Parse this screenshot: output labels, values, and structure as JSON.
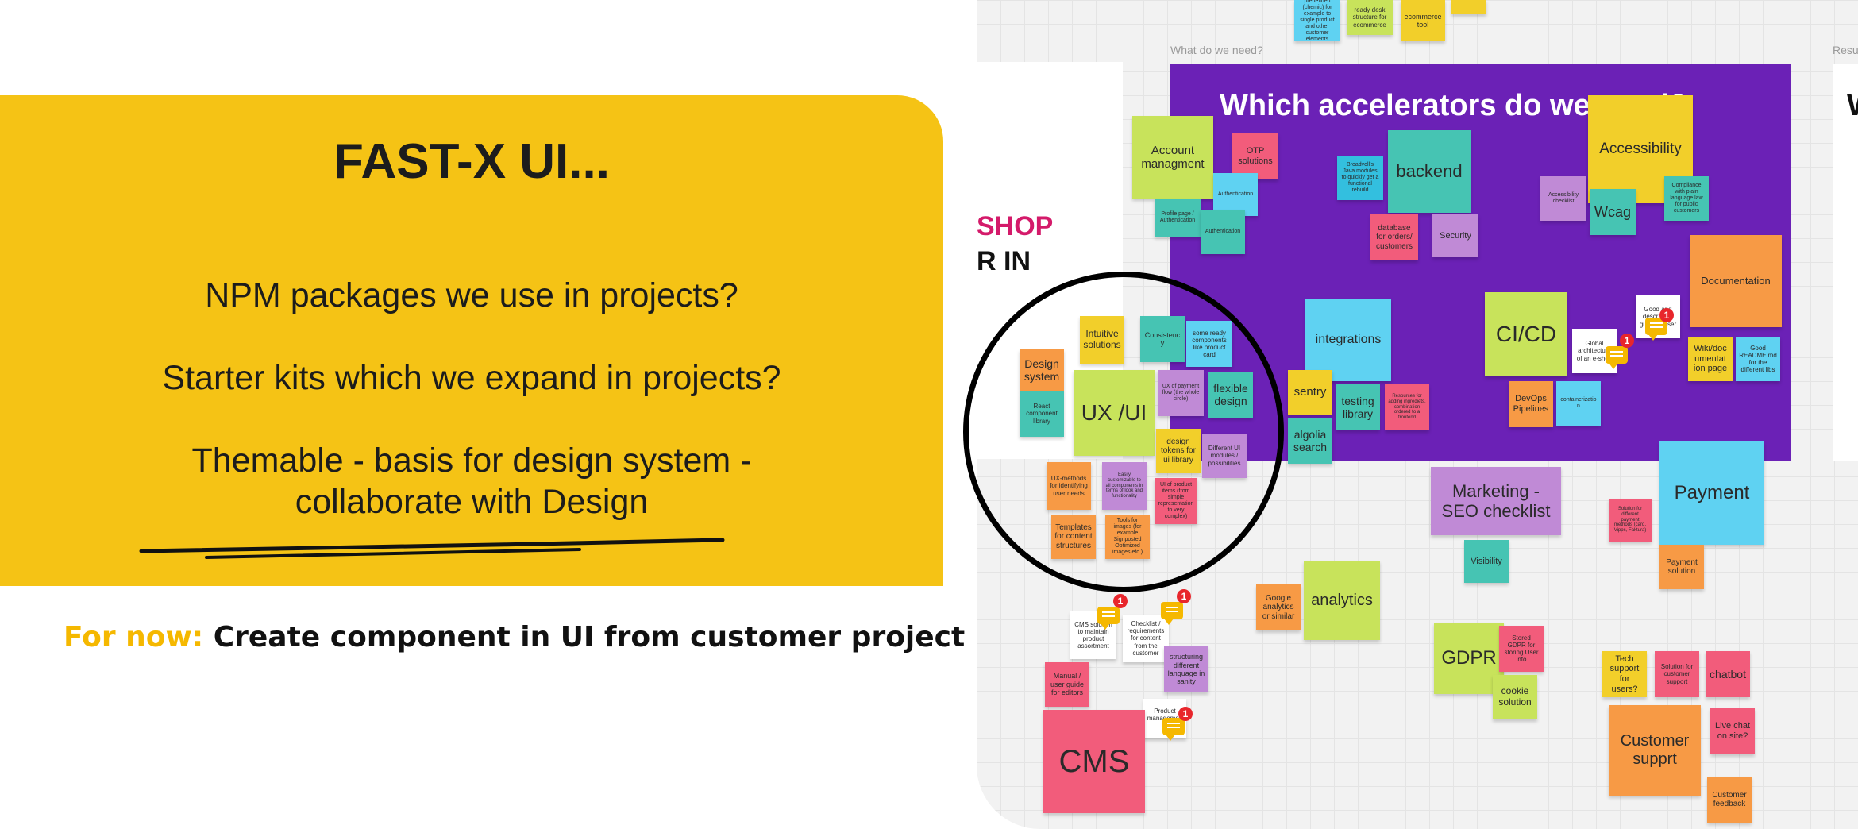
{
  "slide": {
    "title": "FAST-X UI...",
    "lines": [
      "NPM packages we use in projects?",
      "Starter kits which we expand in projects?",
      "Themable - basis for design system -",
      "collaborate with Design"
    ],
    "for_now_label": "For now:",
    "for_now_text": "Create component in UI from customer project",
    "colors": {
      "card": "#f5c315",
      "accent": "#f5b800"
    }
  },
  "board": {
    "frame_label_left": "What do we need?",
    "frame_label_right": "Resu",
    "left_frame_shop": "SHOP",
    "left_frame_rin": "R IN",
    "purple_title": "Which accelerators do we need?",
    "right_frame_letter": "W",
    "purple_color": "#6b21b6",
    "comment_badge": "1",
    "notes": [
      "predefined (chemic) for example to single product and other customer elements",
      "ready desk structure for ecommerce",
      "ecommerce tool",
      "Account managment",
      "OTP solutions",
      "Authentication",
      "Profile page / Authentication",
      "Authentication",
      "Broadvoll's Java modules to quickly get a functional rebuild",
      "backend",
      "database for orders/ customers",
      "Security",
      "Accessibility",
      "Accessibility checklist",
      "Wcag",
      "Compliance with plain language law for public customers",
      "Documentation",
      "Good and descriptive guide to user",
      "Wiki/doc umentat ion page",
      "Good README.md for the different libs",
      "Intuitive solutions",
      "Consistency",
      "some ready components like product card",
      "Design system",
      "React component library",
      "UX /UI",
      "UX of payment flow (the whole circle)",
      "flexible design",
      "design tokens for ui library",
      "Different UI modules / possibilities",
      "integrations",
      "sentry",
      "testing library",
      "Resources for adding ingrediets, combination ordered to a frontend",
      "algolia search",
      "CI/CD",
      "Global architecture of an e-shop",
      "DevOps Pipelines",
      "containerization",
      "UX-methods for identifying user needs",
      "Easily customizable to all components in terms of look and functionality",
      "UI of product items (from simple representation to very complex)",
      "Templates for content structures",
      "Tools for images (for example Signposted Optimized images etc.)",
      "Marketing - SEO checklist",
      "Visibility",
      "Payment",
      "Solution for different payment methods (card, Vipps, Faktura)",
      "Payment solution",
      "Google analytics or similar",
      "analytics",
      "CMS solution to maintain product assortment",
      "Checklist / requirements for content from the customer",
      "structuring different language in sanity",
      "Manual / user guide for editors",
      "Product management",
      "CMS",
      "GDPR",
      "Stored GDPR for storing User info",
      "cookie solution",
      "Tech support for users?",
      "Solution for customer support",
      "chatbot",
      "Customer supprt",
      "Live chat on site?",
      "Customer feedback"
    ]
  }
}
